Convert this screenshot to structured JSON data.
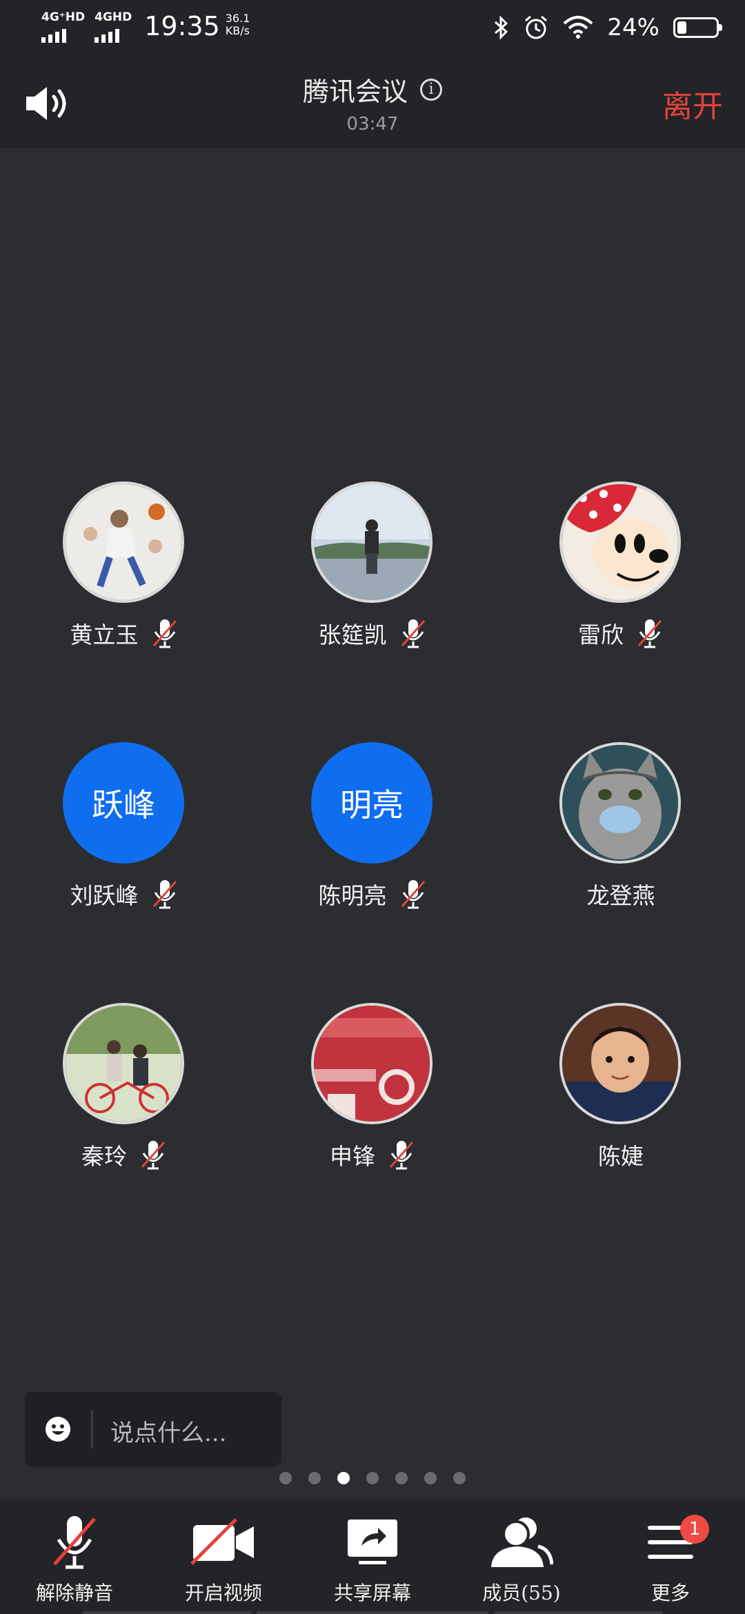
{
  "status_bar": {
    "net1": "4G⁺HD",
    "net2": "4GHD",
    "time": "19:35",
    "speed_value": "36.1",
    "speed_unit": "KB/s",
    "battery_pct": "24%",
    "battery_level": 0.24
  },
  "header": {
    "title": "腾讯会议",
    "info_glyph": "i",
    "timer": "03:47",
    "leave_label": "离开"
  },
  "participants": [
    {
      "name": "黄立玉",
      "muted": true,
      "avatar": "photo",
      "avatar_desc": "basketball-player"
    },
    {
      "name": "张筵凯",
      "muted": true,
      "avatar": "photo",
      "avatar_desc": "person-by-lake"
    },
    {
      "name": "雷欣",
      "muted": true,
      "avatar": "photo",
      "avatar_desc": "cartoon-mouse"
    },
    {
      "name": "刘跃峰",
      "muted": true,
      "avatar": "text",
      "avatar_text": "跃峰"
    },
    {
      "name": "陈明亮",
      "muted": true,
      "avatar": "text",
      "avatar_text": "明亮"
    },
    {
      "name": "龙登燕",
      "muted": false,
      "avatar": "photo",
      "avatar_desc": "cat-with-mask"
    },
    {
      "name": "秦玲",
      "muted": true,
      "avatar": "photo",
      "avatar_desc": "family-on-bike"
    },
    {
      "name": "申锋",
      "muted": true,
      "avatar": "photo",
      "avatar_desc": "red-card"
    },
    {
      "name": "陈婕",
      "muted": false,
      "avatar": "photo",
      "avatar_desc": "child-portrait"
    }
  ],
  "chat": {
    "placeholder": "说点什么..."
  },
  "pagination": {
    "total": 7,
    "current": 3
  },
  "toolbar": {
    "unmute_label": "解除静音",
    "video_label": "开启视频",
    "share_label": "共享屏幕",
    "members_label": "成员(55)",
    "more_label": "更多",
    "more_badge": "1"
  },
  "colors": {
    "leave": "#e3433c",
    "avatar_blue": "#0f6ef0",
    "badge": "#f14a45",
    "background": "#2b2d31"
  }
}
